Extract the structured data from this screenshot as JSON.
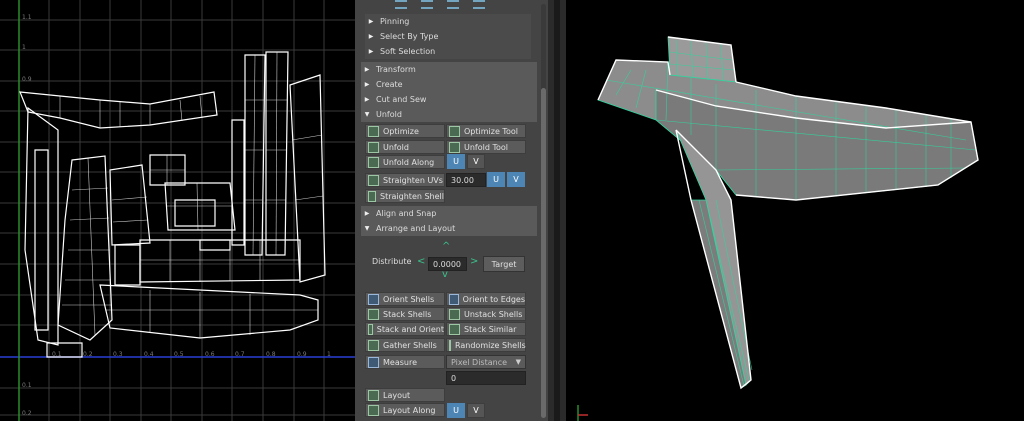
{
  "uv_editor": {
    "y_ticks": [
      "1.1",
      "1",
      "0.9",
      "0.1",
      "0.2"
    ],
    "x_ticks": [
      "0.1",
      "0.2",
      "0.3",
      "0.4",
      "0.5",
      "0.6",
      "0.7",
      "0.8",
      "0.9",
      "1"
    ]
  },
  "panel": {
    "subsections": [
      "Pinning",
      "Select By Type",
      "Soft Selection"
    ],
    "sections": {
      "transform": "Transform",
      "create": "Create",
      "cut_sew": "Cut and Sew",
      "unfold": "Unfold",
      "align_snap": "Align and Snap",
      "arrange_layout": "Arrange and Layout"
    },
    "unfold_tools": {
      "optimize": "Optimize",
      "optimize_tool": "Optimize Tool",
      "unfold": "Unfold",
      "unfold_tool": "Unfold Tool",
      "unfold_along": "Unfold Along",
      "straighten_uvs": "Straighten UVs",
      "straighten_value": "30.00",
      "straighten_shell": "Straighten Shell",
      "u": "U",
      "v": "V"
    },
    "arrange": {
      "distribute_label": "Distribute",
      "distribute_value": "0.0000",
      "target": "Target",
      "orient_shells": "Orient Shells",
      "orient_to_edges": "Orient to Edges",
      "stack_shells": "Stack Shells",
      "unstack_shells": "Unstack Shells",
      "stack_and_orient": "Stack and Orient",
      "stack_similar": "Stack Similar",
      "gather_shells": "Gather Shells",
      "randomize_shells": "Randomize Shells",
      "measure": "Measure",
      "measure_mode": "Pixel Distance",
      "measure_value": "0",
      "layout": "Layout",
      "layout_along": "Layout Along",
      "u": "U",
      "v": "V"
    }
  },
  "colors": {
    "panel_bg": "#444444",
    "section_bg": "#5a5a5a",
    "accent_blue": "#4d86b5",
    "wire_green": "#2fd6a0",
    "grid_line": "#3a3a3a",
    "axis_blue": "#2a3fd6",
    "axis_green": "#2a8c2a"
  }
}
